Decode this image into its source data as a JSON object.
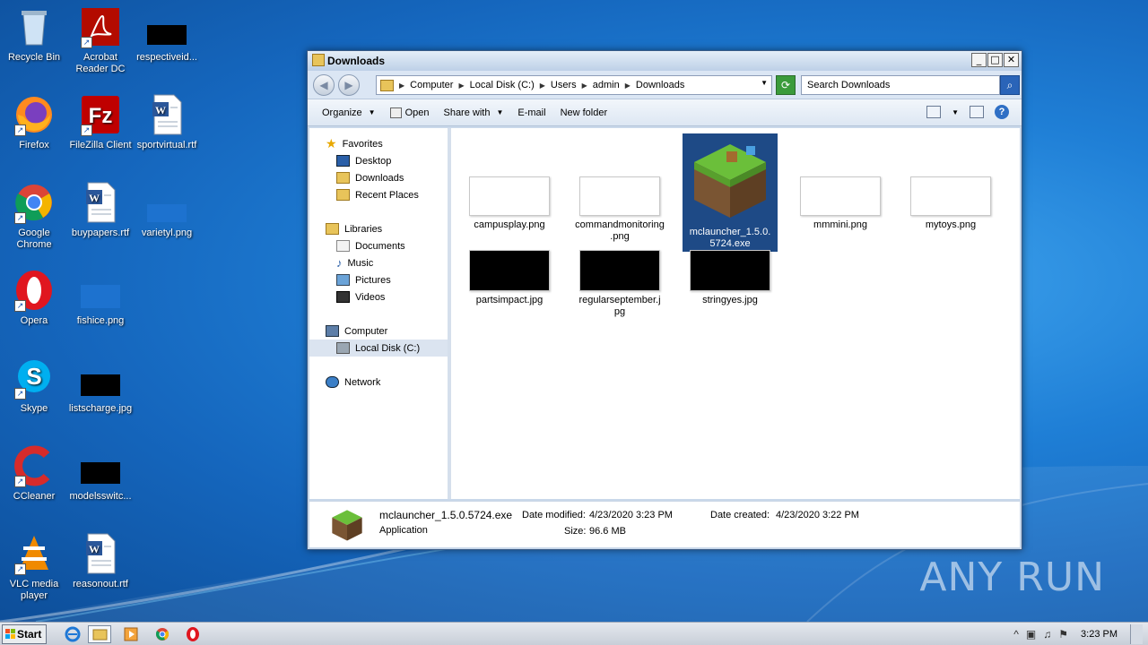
{
  "desktop": {
    "icons": [
      {
        "label": "Recycle Bin",
        "name": "recycle-bin-icon"
      },
      {
        "label": "Acrobat Reader DC",
        "name": "acrobat-reader-icon"
      },
      {
        "label": "respectiveid...",
        "name": "file-respectiveid-icon"
      },
      {
        "label": "Firefox",
        "name": "firefox-icon"
      },
      {
        "label": "FileZilla Client",
        "name": "filezilla-icon"
      },
      {
        "label": "sportvirtual.rtf",
        "name": "rtf-file-icon"
      },
      {
        "label": "Google Chrome",
        "name": "chrome-icon"
      },
      {
        "label": "buypapers.rtf",
        "name": "rtf-file-icon"
      },
      {
        "label": "varietyl.png",
        "name": "png-file-icon"
      },
      {
        "label": "Opera",
        "name": "opera-icon"
      },
      {
        "label": "fishice.png",
        "name": "png-file-icon"
      },
      {
        "label": "Skype",
        "name": "skype-icon"
      },
      {
        "label": "listscharge.jpg",
        "name": "jpg-file-icon"
      },
      {
        "label": "CCleaner",
        "name": "ccleaner-icon"
      },
      {
        "label": "modelsswitc...",
        "name": "file-modelsswitc-icon"
      },
      {
        "label": "VLC media player",
        "name": "vlc-icon"
      },
      {
        "label": "reasonout.rtf",
        "name": "rtf-file-icon"
      }
    ],
    "watermark": "ANY RUN"
  },
  "window": {
    "title": "Downloads",
    "buttons": {
      "minimize": "_",
      "maximize": "□",
      "close": "✕"
    },
    "address": {
      "crumbs": [
        "Computer",
        "Local Disk (C:)",
        "Users",
        "admin",
        "Downloads"
      ]
    },
    "search": {
      "placeholder": "Search Downloads"
    },
    "toolbar": {
      "organize": "Organize",
      "open": "Open",
      "share_with": "Share with",
      "email": "E-mail",
      "new_folder": "New folder"
    },
    "nav": {
      "favorites": "Favorites",
      "desktop": "Desktop",
      "downloads": "Downloads",
      "recent": "Recent Places",
      "libraries": "Libraries",
      "documents": "Documents",
      "music": "Music",
      "pictures": "Pictures",
      "videos": "Videos",
      "computer": "Computer",
      "local_disk": "Local Disk (C:)",
      "network": "Network"
    },
    "files": [
      {
        "line1": "campusplay.png",
        "line2": ""
      },
      {
        "line1": "commandmonitoring",
        "line2": ".png"
      },
      {
        "line1": "mclauncher_1.5.0.",
        "line2": "5724.exe"
      },
      {
        "line1": "mmmini.png",
        "line2": ""
      },
      {
        "line1": "mytoys.png",
        "line2": ""
      },
      {
        "line1": "partsimpact.jpg",
        "line2": ""
      },
      {
        "line1": "regularseptember.j",
        "line2": "pg"
      },
      {
        "line1": "stringyes.jpg",
        "line2": ""
      }
    ],
    "details": {
      "filename": "mclauncher_1.5.0.5724.exe",
      "type": "Application",
      "modified_label": "Date modified:",
      "modified_value": "4/23/2020 3:23 PM",
      "created_label": "Date created:",
      "created_value": "4/23/2020 3:22 PM",
      "size_label": "Size:",
      "size_value": "96.6 MB"
    }
  },
  "taskbar": {
    "start": "Start",
    "clock": "3:23 PM"
  },
  "colors": {
    "selection": "#1e4a86",
    "desktop_blue": "#1f7fd6"
  }
}
